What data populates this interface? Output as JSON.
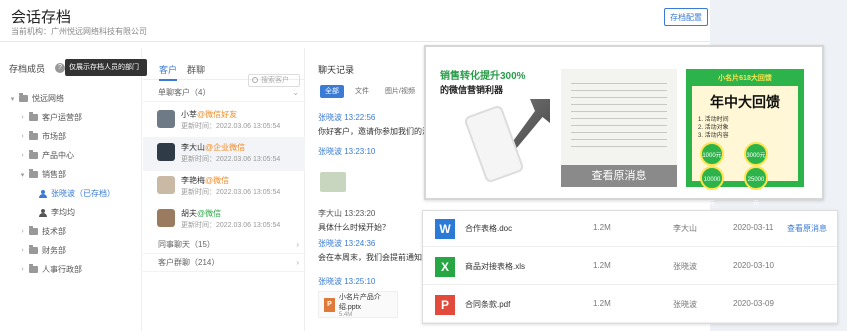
{
  "header": {
    "title": "会话存档",
    "subtitle": "当前机构：广州悦远网络科技有限公司",
    "button_label": "存档配置"
  },
  "sidebar": {
    "heading": "存档成员",
    "help": "?",
    "tooltip": "仅展示存档人员的部门",
    "tree": [
      {
        "label": "悦远网络",
        "arrow": "▾",
        "type": "folder",
        "indent": 0
      },
      {
        "label": "客户运营部",
        "arrow": "›",
        "type": "folder",
        "indent": 1
      },
      {
        "label": "市场部",
        "arrow": "›",
        "type": "folder",
        "indent": 1
      },
      {
        "label": "产品中心",
        "arrow": "›",
        "type": "folder",
        "indent": 1
      },
      {
        "label": "销售部",
        "arrow": "▾",
        "type": "folder",
        "indent": 1
      },
      {
        "label": "张晓波（已存档）",
        "arrow": "",
        "type": "person",
        "indent": 2,
        "selected": true
      },
      {
        "label": "李均均",
        "arrow": "",
        "type": "person",
        "indent": 2
      },
      {
        "label": "技术部",
        "arrow": "›",
        "type": "folder",
        "indent": 1
      },
      {
        "label": "财务部",
        "arrow": "›",
        "type": "folder",
        "indent": 1
      },
      {
        "label": "人事行政部",
        "arrow": "›",
        "type": "folder",
        "indent": 1
      }
    ]
  },
  "middle": {
    "tabs": [
      "客户",
      "群聊"
    ],
    "search_placeholder": "搜索客户",
    "groups": {
      "single": "单聊客户（4）",
      "colleague": "同事聊天（15）",
      "group": "客户群聊（214）"
    },
    "contacts": [
      {
        "name": "小莘",
        "tag": "@微信好友",
        "tag_type": "orange",
        "time": "更新时间：2022.03.06 13:05:54",
        "avatar_color": "#6e7b87"
      },
      {
        "name": "李大山",
        "tag": "@企业微信",
        "tag_type": "orange",
        "time": "更新时间：2022.03.06 13:05:54",
        "avatar_color": "#2f3b46"
      },
      {
        "name": "李艳梅",
        "tag": "@微信",
        "tag_type": "orange",
        "time": "更新时间：2022.03.06 13:05:54",
        "avatar_color": "#c9b9a5"
      },
      {
        "name": "胡夫",
        "tag": "@微信",
        "tag_type": "green",
        "time": "更新时间：2022.03.06 13:05:54",
        "avatar_color": "#9a7b60"
      }
    ]
  },
  "chat": {
    "heading": "聊天记录",
    "tabs": [
      "全部",
      "文件",
      "图片/视频"
    ],
    "messages": [
      {
        "sender": "",
        "time": "张晓波 13:22:56",
        "body": "你好客户，邀请你参加我们的活动"
      },
      {
        "sender": "张晓波",
        "time": "13:23:10",
        "body": ""
      },
      {
        "sender": "",
        "time": "李大山 13:23:20",
        "body": "具体什么时候开始？"
      },
      {
        "sender": "张晓波",
        "time": "13:24:36",
        "body": "会在本周末，我们会提前通知您，敬请期待"
      },
      {
        "sender": "张晓波",
        "time": "13:25:10",
        "body": ""
      }
    ],
    "file_card": {
      "name": "小名片产品介绍.pptx",
      "size": "5.4M",
      "icon": "P"
    }
  },
  "images": {
    "img1": {
      "line1": "销售转化提升300%",
      "line2": "的微信营销利器"
    },
    "img2": {
      "button": "查看原消息"
    },
    "img3": {
      "top": "小名片618大回馈",
      "big": "年中大回馈",
      "rows": [
        "1. 活动时间",
        "2. 活动对象",
        "3. 活动内容"
      ],
      "c1": "1000元",
      "c2": "3000元",
      "c3": "10000元",
      "c4": "25000元"
    }
  },
  "files": [
    {
      "icon": "W",
      "icon_type": "w",
      "name": "合作表格.doc",
      "size": "1.2M",
      "who": "李大山",
      "date": "2020-03-11",
      "action": "查看原消息"
    },
    {
      "icon": "X",
      "icon_type": "x",
      "name": "商品对接表格.xls",
      "size": "1.2M",
      "who": "张晓波",
      "date": "2020-03-10",
      "action": ""
    },
    {
      "icon": "P",
      "icon_type": "p",
      "name": "合同条款.pdf",
      "size": "1.2M",
      "who": "张晓波",
      "date": "2020-03-09",
      "action": ""
    }
  ]
}
